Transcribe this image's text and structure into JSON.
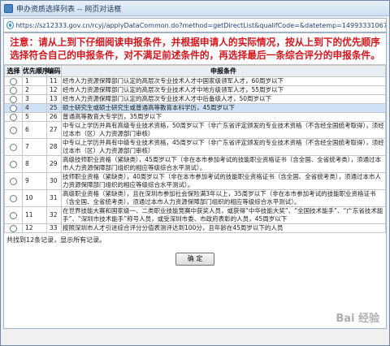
{
  "window": {
    "title": "申办资质选择列表 -- 网页对话框",
    "url": "https://sz12333.gov.cn/rcyj/applyDataCommon.do?method=getDirectList&qualifCode=&datetemp=1499333106774&csrftoken=1b148dC"
  },
  "notice": "注意：请从上到下仔细阅读申报条件，并根据申请人的实际情况，按从上到下的优先顺序选择符合自己的申报条件，对不满足前述条件的，再选择最后一条综合评分的申报条件。",
  "table": {
    "headers": [
      "选择",
      "优先顺序",
      "编码",
      "申报条件"
    ],
    "rows": [
      {
        "order": "1",
        "code": "11",
        "condition": "经市人力资源保障部门认定的高层次专业技术人才中国家级领军人才，60周岁以下",
        "selected": false
      },
      {
        "order": "2",
        "code": "12",
        "condition": "经市人力资源保障部门认定的高层次专业技术人才中地方级领军人才，55周岁以下",
        "selected": false
      },
      {
        "order": "3",
        "code": "13",
        "condition": "经市人力资源保障部门认定的高层次专业技术人才中后备级人才，50周岁以下",
        "selected": false
      },
      {
        "order": "4",
        "code": "25",
        "condition": "硕士研究生或硕士研究生或普通高等教育本科学历，45周岁以下",
        "selected": true
      },
      {
        "order": "5",
        "code": "26",
        "condition": "普通高等教育大专学历，35周岁以下",
        "selected": false
      },
      {
        "order": "6",
        "code": "27",
        "condition": "中专以上学历并具有高级专业技术资格，50周岁以下（非广东省评定颁发的专业技术资格（不含经全国统考取得），须经过本市（区）人力资源部门审核）",
        "selected": false
      },
      {
        "order": "7",
        "code": "28",
        "condition": "中专以上学历并具有中级专业技术资格，45周岁以下（非广东省评定颁发的专业技术资格（不含经全国统考取得），须经过本市（区）人力资源部门审核）",
        "selected": false
      },
      {
        "order": "8",
        "code": "29",
        "condition": "高级技师职业资格（紧缺类），45周岁以下（非在本市参加考试的技能职业资格证书（含全国、全省统考类），须通过本市人力资源保障部门组织的相应等级综合水平测试）。",
        "selected": false
      },
      {
        "order": "9",
        "code": "30",
        "condition": "技师职业资格（紧缺类），40周岁以下（非在本市参加考试的技能职业资格证书（含全国、全省统考类），须通过本市人力资源保障部门组织的相应等级综合水平测试）。",
        "selected": false
      },
      {
        "order": "10",
        "code": "31",
        "condition": "高级职业资格（紧缺类），且在深圳市参加社会保险满3年以上，35周岁以下（非在本市参加考试的技能职业资格证书（含全国、全省统考类），须通过本市人力资源保障部门组织的相应等级综合水平测试）。",
        "selected": false
      },
      {
        "order": "11",
        "code": "32",
        "condition": "在世界技能大赛和国家级一、二类职业技能竞赛中获奖人员，或获得“中华技能大奖”、“全国技术能手”、“广东省技术能手”、“深圳市技术能手”称号人员，或受深圳市委、市政府表彰的人员，45周岁以下",
        "selected": false
      },
      {
        "order": "12",
        "code": "33",
        "condition": "按照深圳市人才引进综合评分分值表测评达到100分，且年龄在45周岁以下的人员",
        "selected": false
      }
    ]
  },
  "footer": {
    "summary": "共找到12条记录，显示所有记录。",
    "confirm_label": "确 定"
  },
  "watermark": "Bai 经验"
}
